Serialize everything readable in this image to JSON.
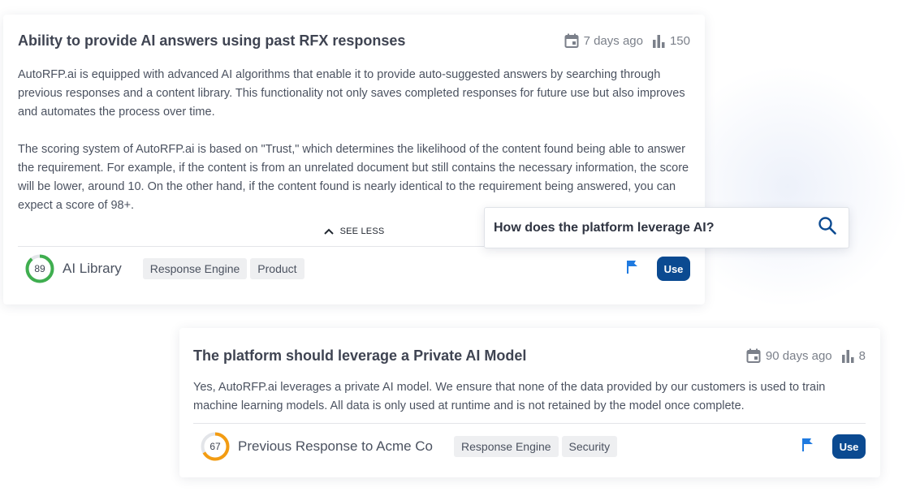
{
  "cards": [
    {
      "title": "Ability to provide AI answers using past RFX responses",
      "date": "7 days ago",
      "count": "150",
      "paragraphs": [
        "AutoRFP.ai is equipped with advanced AI algorithms that enable it to provide auto-suggested answers by searching through previous responses and a content library. This functionality not only saves completed responses for future use but also improves and automates the process over time.",
        "The scoring system of AutoRFP.ai is based on \"Trust,\" which determines the likelihood of the content found being able to answer the requirement. For example, if the content is from an unrelated document but still contains the necessary information, the score will be lower, around 10. On the other hand, if the content found is nearly identical to the requirement being answered, you can expect a score of 98+."
      ],
      "see_less_label": "SEE LESS",
      "score": 89,
      "score_label": "89",
      "score_color": "#3fae4f",
      "source": "AI Library",
      "tags": [
        "Response Engine",
        "Product"
      ],
      "use_label": "Use"
    },
    {
      "title": "The platform should leverage a Private AI Model",
      "date": "90 days ago",
      "count": "8",
      "paragraphs": [
        "Yes, AutoRFP.ai leverages a private AI model. We ensure that none of the data provided by our customers is used to train machine learning models. All data is only used at runtime and is not retained by the model once complete."
      ],
      "score": 67,
      "score_label": "67",
      "score_color": "#f39c12",
      "source": "Previous Response to Acme Co",
      "tags": [
        "Response Engine",
        "Security"
      ],
      "use_label": "Use"
    }
  ],
  "search": {
    "query": "How does the platform leverage AI?",
    "icon": "search-icon"
  },
  "colors": {
    "accent": "#0b4a91",
    "flag": "#1f7ae0",
    "ring_track": "#e3e5e9"
  }
}
